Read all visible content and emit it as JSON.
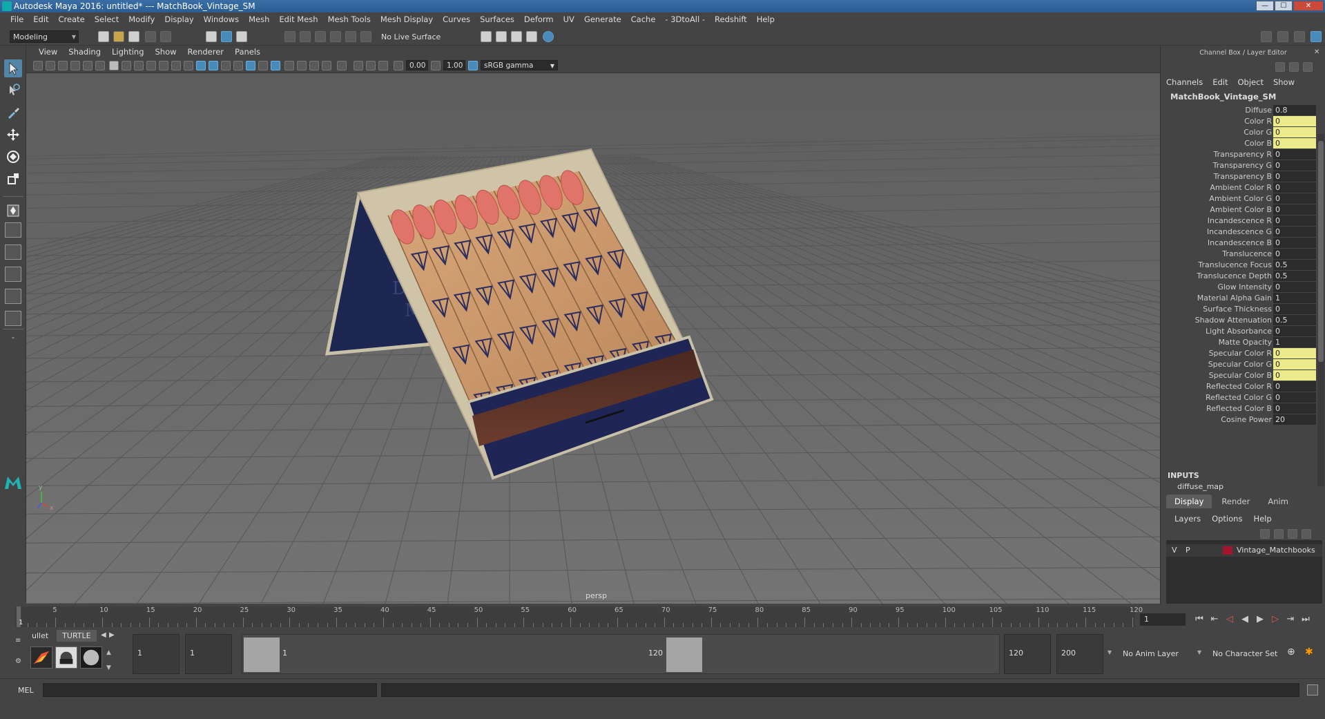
{
  "window": {
    "title": "Autodesk Maya 2016: untitled*   ---   MatchBook_Vintage_SM",
    "min_label": "—",
    "max_label": "☐",
    "close_label": "✕"
  },
  "menubar": [
    "File",
    "Edit",
    "Create",
    "Select",
    "Modify",
    "Display",
    "Windows",
    "Mesh",
    "Edit Mesh",
    "Mesh Tools",
    "Mesh Display",
    "Curves",
    "Surfaces",
    "Deform",
    "UV",
    "Generate",
    "Cache",
    "- 3DtoAll -",
    "Redshift",
    "Help"
  ],
  "statusline": {
    "mode": "Modeling",
    "live_surface": "No Live Surface"
  },
  "viewport": {
    "menu": [
      "View",
      "Shading",
      "Lighting",
      "Show",
      "Renderer",
      "Panels"
    ],
    "exposure": "0.00",
    "gamma": "1.00",
    "color_space": "sRGB gamma",
    "camera_label": "persp",
    "cover_text_1": "D",
    "cover_text_2": "M",
    "axis_y": "y",
    "axis_x": "x"
  },
  "channel_box": {
    "title": "Channel Box / Layer Editor",
    "menu": [
      "Channels",
      "Edit",
      "Object",
      "Show"
    ],
    "object_name": "MatchBook_Vintage_SM",
    "attributes": [
      {
        "label": "Diffuse",
        "value": "0.8",
        "highlight": false
      },
      {
        "label": "Color R",
        "value": "0",
        "highlight": true
      },
      {
        "label": "Color G",
        "value": "0",
        "highlight": true
      },
      {
        "label": "Color B",
        "value": "0",
        "highlight": true
      },
      {
        "label": "Transparency R",
        "value": "0",
        "highlight": false
      },
      {
        "label": "Transparency G",
        "value": "0",
        "highlight": false
      },
      {
        "label": "Transparency B",
        "value": "0",
        "highlight": false
      },
      {
        "label": "Ambient Color R",
        "value": "0",
        "highlight": false
      },
      {
        "label": "Ambient Color G",
        "value": "0",
        "highlight": false
      },
      {
        "label": "Ambient Color B",
        "value": "0",
        "highlight": false
      },
      {
        "label": "Incandescence R",
        "value": "0",
        "highlight": false
      },
      {
        "label": "Incandescence G",
        "value": "0",
        "highlight": false
      },
      {
        "label": "Incandescence B",
        "value": "0",
        "highlight": false
      },
      {
        "label": "Translucence",
        "value": "0",
        "highlight": false
      },
      {
        "label": "Translucence Focus",
        "value": "0.5",
        "highlight": false
      },
      {
        "label": "Translucence Depth",
        "value": "0.5",
        "highlight": false
      },
      {
        "label": "Glow Intensity",
        "value": "0",
        "highlight": false
      },
      {
        "label": "Material Alpha Gain",
        "value": "1",
        "highlight": false
      },
      {
        "label": "Surface Thickness",
        "value": "0",
        "highlight": false
      },
      {
        "label": "Shadow Attenuation",
        "value": "0.5",
        "highlight": false
      },
      {
        "label": "Light Absorbance",
        "value": "0",
        "highlight": false
      },
      {
        "label": "Matte Opacity",
        "value": "1",
        "highlight": false
      },
      {
        "label": "Specular Color R",
        "value": "0",
        "highlight": true
      },
      {
        "label": "Specular Color G",
        "value": "0",
        "highlight": true
      },
      {
        "label": "Specular Color B",
        "value": "0",
        "highlight": true
      },
      {
        "label": "Reflected Color R",
        "value": "0",
        "highlight": false
      },
      {
        "label": "Reflected Color G",
        "value": "0",
        "highlight": false
      },
      {
        "label": "Reflected Color B",
        "value": "0",
        "highlight": false
      },
      {
        "label": "Cosine Power",
        "value": "20",
        "highlight": false
      }
    ],
    "inputs_header": "INPUTS",
    "inputs_item": "diffuse_map"
  },
  "layer_editor": {
    "tabs": [
      "Display",
      "Render",
      "Anim"
    ],
    "menu": [
      "Layers",
      "Options",
      "Help"
    ],
    "layer": {
      "v": "V",
      "p": "P",
      "name": "Vintage_Matchbooks",
      "color": "#a3162d"
    }
  },
  "timeline": {
    "labels": [
      "5",
      "10",
      "15",
      "20",
      "25",
      "30",
      "35",
      "40",
      "45",
      "50",
      "55",
      "60",
      "65",
      "70",
      "75",
      "80",
      "85",
      "90",
      "95",
      "100",
      "105",
      "110",
      "115",
      "120"
    ],
    "start_label": "1",
    "current_frame": "1"
  },
  "range": {
    "shelf_tabs": [
      "ullet",
      "TURTLE"
    ],
    "start_time": "1",
    "playback_start": "1",
    "slider_start": "1",
    "slider_end": "120",
    "playback_end": "120",
    "end_time": "200",
    "anim_layer": "No Anim Layer",
    "character_set": "No Character Set"
  },
  "command": {
    "label": "MEL"
  }
}
